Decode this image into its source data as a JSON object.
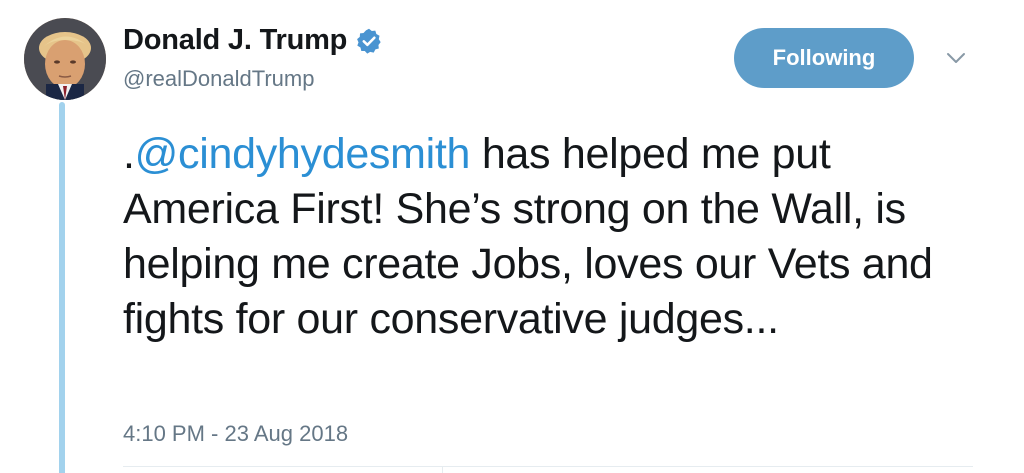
{
  "tweet": {
    "author": {
      "display_name": "Donald J. Trump",
      "handle": "@realDonaldTrump",
      "verified": true,
      "avatar_icon": "profile-photo"
    },
    "follow_button": {
      "label": "Following"
    },
    "menu_icon": "chevron-down-icon",
    "text": {
      "prefix": ".",
      "mention": "@cindyhydesmith",
      "body": " has helped me put America First! She’s strong on the Wall, is helping me create Jobs, loves our Vets and fights for our conservative judges..."
    },
    "timestamp": "4:10 PM - 23 Aug 2018"
  },
  "colors": {
    "accent": "#5e9dc9",
    "mention": "#2b8fd4",
    "thread_line": "#a2d2ed",
    "muted_text": "#657786",
    "primary_text": "#14171a"
  }
}
